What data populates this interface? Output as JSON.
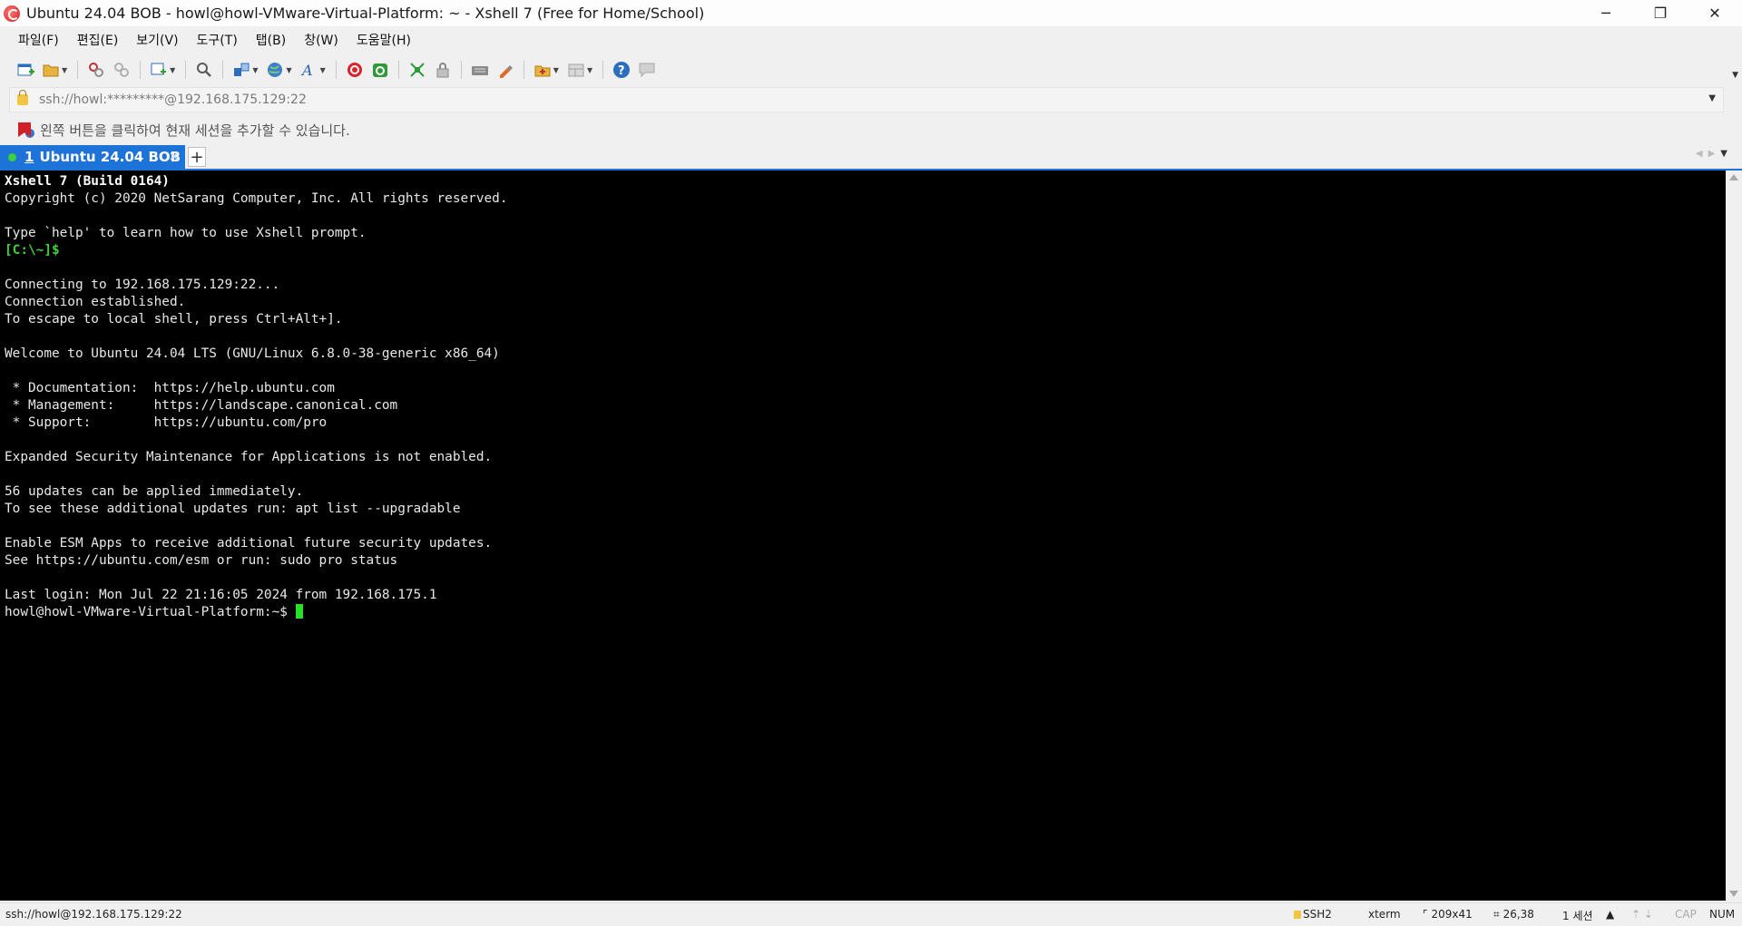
{
  "window": {
    "title": "Ubuntu 24.04 BOB - howl@howl-VMware-Virtual-Platform: ~ - Xshell 7 (Free for Home/School)",
    "controls": {
      "minimize": "─",
      "restore": "❐",
      "close": "✕"
    }
  },
  "menu": {
    "file": "파일(F)",
    "edit": "편집(E)",
    "view": "보기(V)",
    "tools": "도구(T)",
    "tab": "탭(B)",
    "window": "창(W)",
    "help": "도움말(H)"
  },
  "toolbar_icons": [
    "new-session-icon",
    "open-folder-icon",
    "reconnect-icon",
    "disconnect-icon",
    "properties-icon",
    "find-icon",
    "transfer-icon",
    "globe-icon",
    "font-icon",
    "xshell-icon",
    "xftp-icon",
    "fullscreen-icon",
    "lock-icon",
    "keyboard-icon",
    "highlight-icon",
    "script-icon",
    "layout-icon",
    "help-icon",
    "chat-icon"
  ],
  "address": {
    "value": "ssh://howl:*********@192.168.175.129:22"
  },
  "hint": {
    "text": "왼쪽 버튼을 클릭하여 현재 세션을 추가할 수 있습니다."
  },
  "tabs": {
    "active": {
      "number": "1",
      "label": "Ubuntu 24.04 BOB",
      "close": "×"
    },
    "add": "+"
  },
  "terminal": {
    "line_build": "Xshell 7 (Build 0164)",
    "lines_intro": "Copyright (c) 2020 NetSarang Computer, Inc. All rights reserved.\n\nType `help' to learn how to use Xshell prompt.",
    "local_prompt": "[C:\\~]$",
    "lines_body": "\nConnecting to 192.168.175.129:22...\nConnection established.\nTo escape to local shell, press Ctrl+Alt+].\n\nWelcome to Ubuntu 24.04 LTS (GNU/Linux 6.8.0-38-generic x86_64)\n\n * Documentation:  https://help.ubuntu.com\n * Management:     https://landscape.canonical.com\n * Support:        https://ubuntu.com/pro\n\nExpanded Security Maintenance for Applications is not enabled.\n\n56 updates can be applied immediately.\nTo see these additional updates run: apt list --upgradable\n\nEnable ESM Apps to receive additional future security updates.\nSee https://ubuntu.com/esm or run: sudo pro status\n\nLast login: Mon Jul 22 21:16:05 2024 from 192.168.175.1",
    "remote_prompt": "howl@howl-VMware-Virtual-Platform:~$ "
  },
  "status": {
    "connection": "ssh://howl@192.168.175.129:22",
    "protocol": "SSH2",
    "terminal_type": "xterm",
    "size": "209x41",
    "cursor_pos": "26,38",
    "sessions": "1 세션",
    "cap": "CAP",
    "num": "NUM"
  },
  "colors": {
    "accent": "#1e73d8",
    "prompt_green": "#3bd23b",
    "terminal_bg": "#000000"
  }
}
